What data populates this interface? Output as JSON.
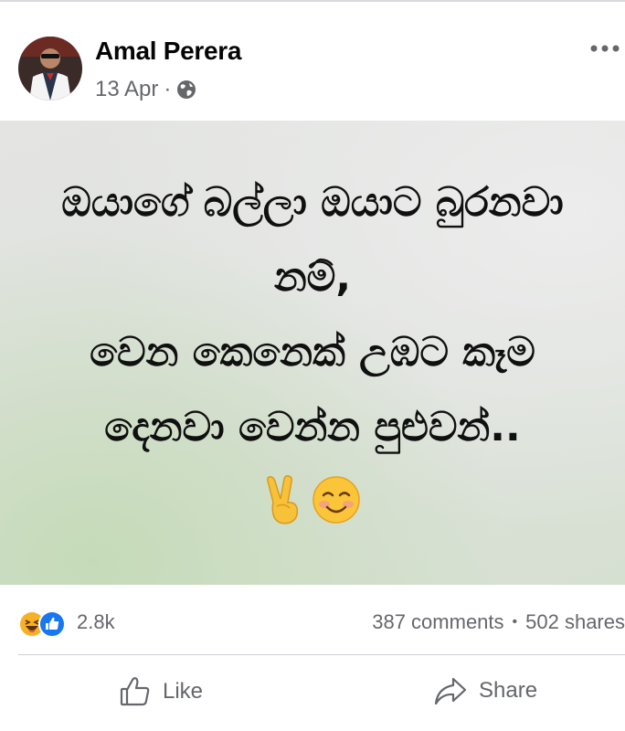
{
  "post": {
    "author": "Amal Perera",
    "date": "13 Apr",
    "meta_separator": "·",
    "privacy_icon": "globe-icon",
    "more_icon": "more-horizontal-icon"
  },
  "image": {
    "lines": [
      "ඔයාගේ බල්ලා ඔයාට බුරනවා",
      "නම්,",
      "වෙන කෙනෙක් උඹට කෑම",
      "දෙනවා වෙන්න පුළුවන්.."
    ],
    "emojis": [
      "✌️",
      "☺️"
    ]
  },
  "stats": {
    "reaction_icons": [
      "haha-reaction-icon",
      "like-reaction-icon"
    ],
    "reaction_count": "2.8k",
    "comments": "387 comments",
    "separator": "•",
    "shares": "502 shares"
  },
  "actions": {
    "like_label": "Like",
    "share_label": "Share"
  },
  "colors": {
    "secondary_text": "#65676b",
    "like_blue": "#1877f2",
    "haha_yellow": "#f7b125"
  }
}
